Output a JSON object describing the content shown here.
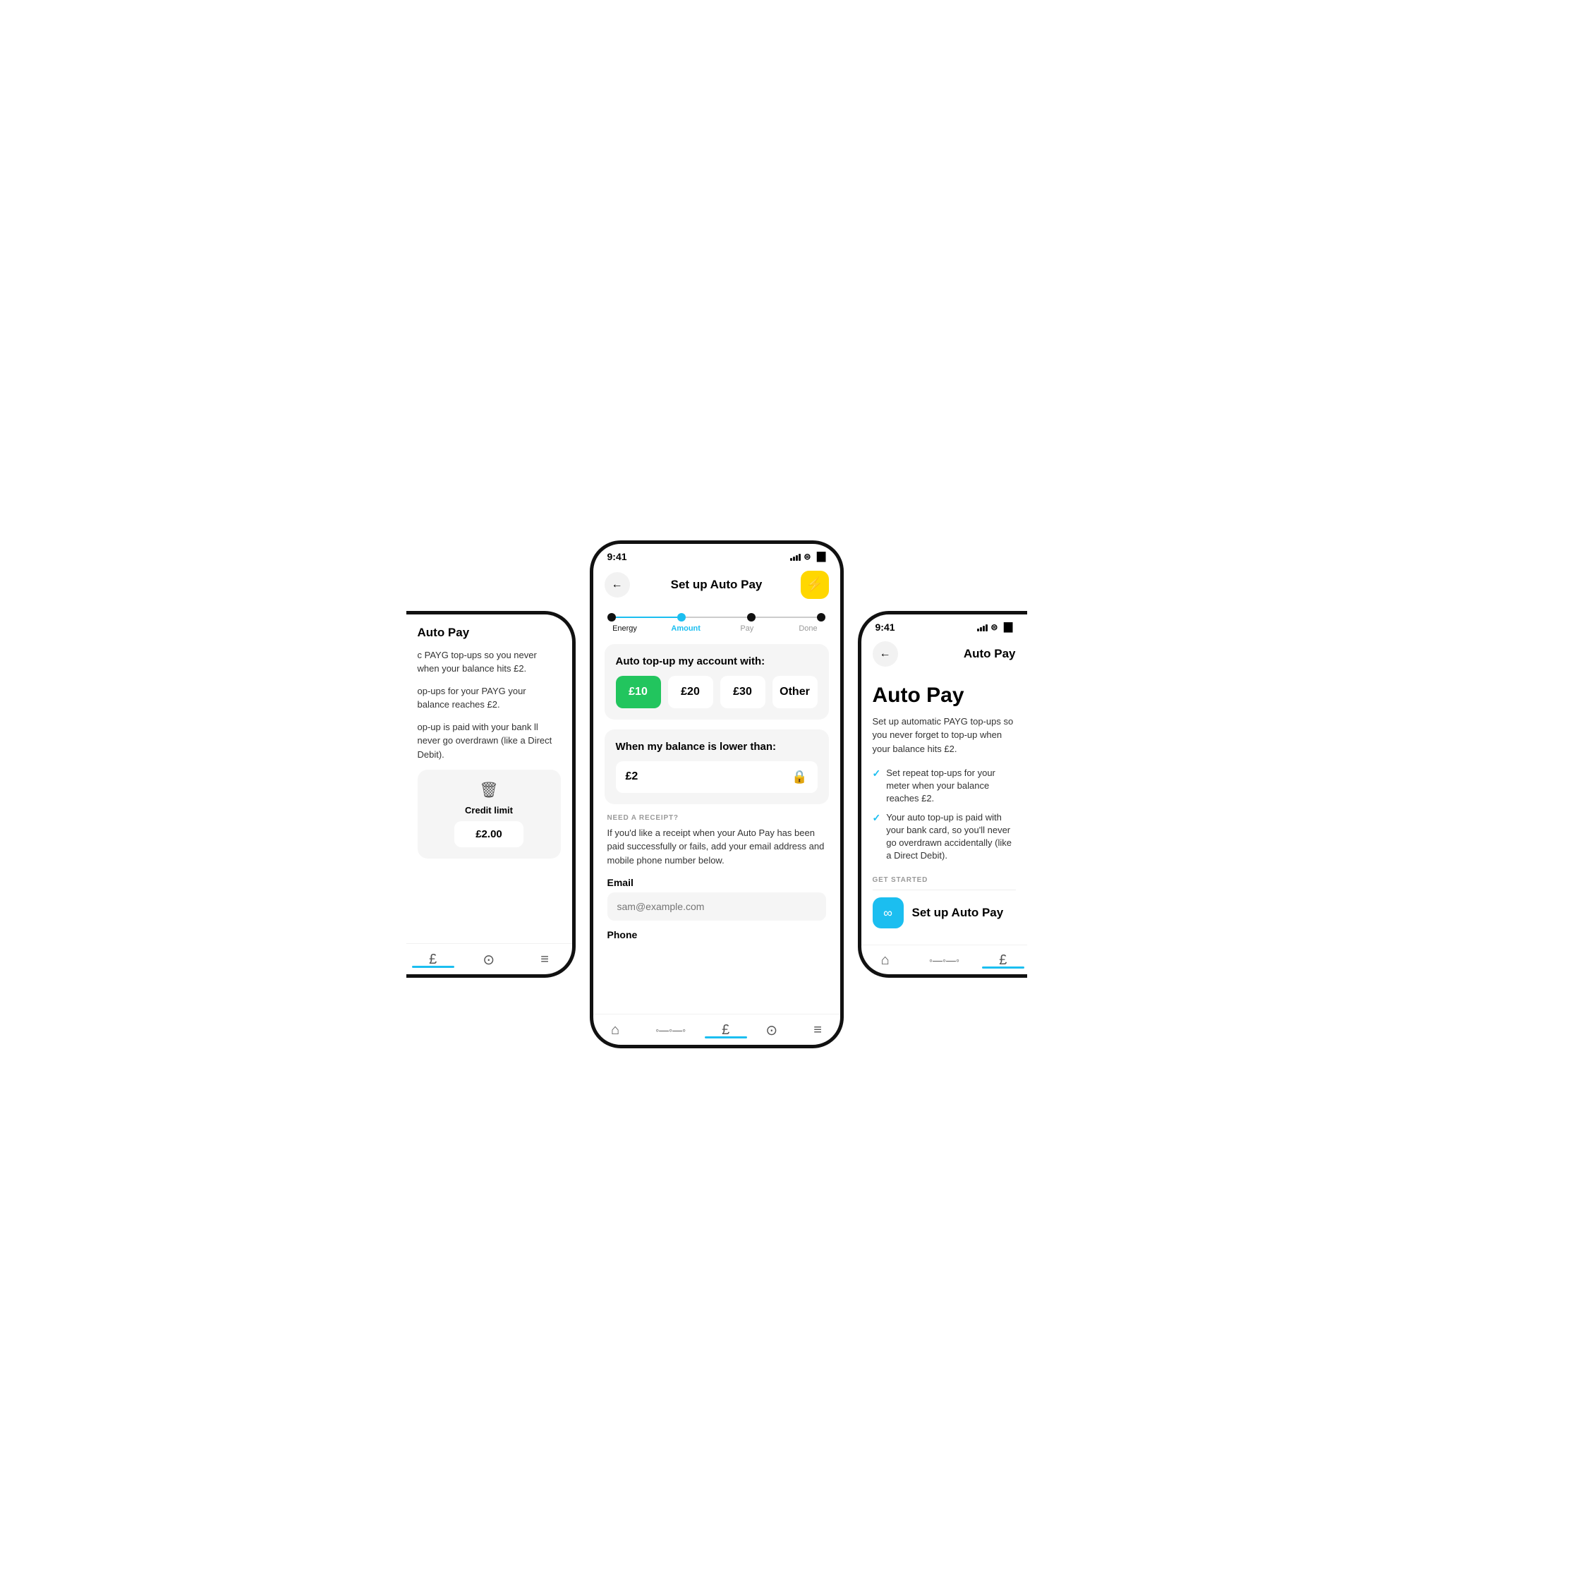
{
  "left_phone": {
    "title": "Auto Pay",
    "body1": "c PAYG top-ups so you never when your balance hits £2.",
    "body2": "op-ups for your PAYG your balance reaches £2.",
    "body3": "op-up is paid with your bank ll never go overdrawn (like a Direct Debit).",
    "credit_label": "Credit limit",
    "credit_value": "£2.00",
    "nav": {
      "items": [
        "£",
        "?",
        "≡"
      ]
    }
  },
  "center_phone": {
    "time": "9:41",
    "back_label": "←",
    "title": "Set up Auto Pay",
    "stepper": {
      "steps": [
        "Energy",
        "Amount",
        "Pay",
        "Done"
      ],
      "active": 1
    },
    "section_topup": {
      "title": "Auto top-up my account with:",
      "amounts": [
        "£10",
        "£20",
        "£30",
        "Other"
      ],
      "selected": 0
    },
    "section_balance": {
      "title": "When my balance is lower than:",
      "value": "£2"
    },
    "receipt": {
      "label": "NEED A RECEIPT?",
      "desc": "If you'd like a receipt when your Auto Pay has been paid successfully or fails, add your email address and mobile phone number below."
    },
    "email_label": "Email",
    "email_placeholder": "sam@example.com",
    "phone_label": "Phone",
    "nav_items": [
      "🏠",
      "◦◦◦",
      "£",
      "?",
      "≡"
    ]
  },
  "right_phone": {
    "time": "9:41",
    "back_label": "←",
    "header_title": "Auto Pay",
    "big_title": "Auto Pay",
    "desc": "Set up automatic PAYG top-ups so you never forget to top-up when your balance hits £2.",
    "checklist": [
      "Set repeat top-ups for your meter when your balance reaches £2.",
      "Your auto top-up is paid with your bank card, so you'll never go overdrawn accidentally (like a Direct Debit)."
    ],
    "get_started_label": "GET STARTED",
    "setup_btn_label": "Set up Auto Pay",
    "nav_items": [
      "🏠",
      "◦◦◦",
      "£"
    ]
  }
}
